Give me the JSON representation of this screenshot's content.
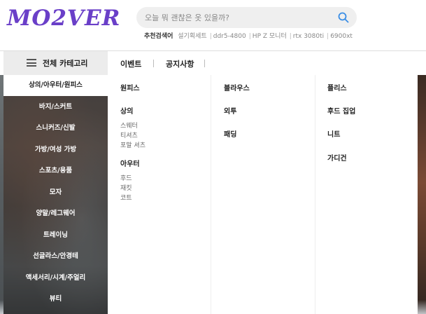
{
  "header": {
    "logo": "MO2VER",
    "search_placeholder": "오늘 뭐 괜찮은 옷 있을까?",
    "keywords_label": "추천검색어",
    "keywords": [
      "설기획세트",
      "ddr5-4800",
      "HP Z 모니터",
      "rtx 3080ti",
      "6900xt"
    ]
  },
  "nav": {
    "categories_toggle": "전체 카테고리",
    "links": [
      "이벤트",
      "공지사항"
    ]
  },
  "sidebar": {
    "items": [
      "상의/아우터/원피스",
      "바지/스커트",
      "스니커즈/신발",
      "가방/여성 가방",
      "스포츠/용품",
      "모자",
      "양말/레그웨어",
      "트레이닝",
      "선글라스/안경테",
      "액세서리/시계/주얼리",
      "뷰티"
    ],
    "active_index": 0
  },
  "mega_menu": {
    "col1": {
      "dress": "원피스",
      "tops": "상의",
      "tops_items": [
        "스웨터",
        "티셔츠",
        "포말 셔츠"
      ],
      "outer": "아우터",
      "outer_items": [
        "후드",
        "재킷",
        "코트"
      ]
    },
    "col2": {
      "blouse": "블라우스",
      "outerwear": "외투",
      "padding": "패딩"
    },
    "col3": {
      "fleece": "플리스",
      "hood_zipup": "후드 집업",
      "knit": "니트",
      "cardigan": "가디건"
    }
  },
  "colors": {
    "brand": "#6a3fc8",
    "search_icon": "#3a8ee6"
  }
}
